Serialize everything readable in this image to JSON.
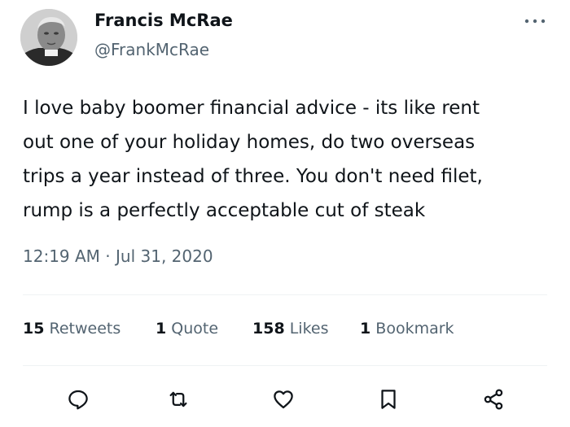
{
  "author": {
    "display_name": "Francis McRae",
    "handle": "@FrankMcRae",
    "avatar_icon": "profile-photo"
  },
  "more_icon": "more-horizontal-icon",
  "tweet": {
    "text_lines": [
      "I love baby boomer financial advice - its like rent",
      "out one of your holiday homes, do two overseas",
      "trips a year instead of three. You don't need filet,",
      "rump is a perfectly acceptable cut of steak"
    ],
    "timestamp": "12:19 AM · Jul 31, 2020"
  },
  "stats": [
    {
      "count": "15",
      "label": "Retweets"
    },
    {
      "count": "1",
      "label": "Quote"
    },
    {
      "count": "158",
      "label": "Likes"
    },
    {
      "count": "1",
      "label": "Bookmark"
    }
  ],
  "actions": [
    {
      "name": "reply",
      "icon": "reply-icon"
    },
    {
      "name": "retweet",
      "icon": "retweet-icon"
    },
    {
      "name": "like",
      "icon": "heart-icon"
    },
    {
      "name": "bookmark",
      "icon": "bookmark-icon"
    },
    {
      "name": "share",
      "icon": "share-icon"
    }
  ],
  "colors": {
    "text_primary": "#0f1419",
    "text_secondary": "#536471",
    "divider": "#eff3f4"
  }
}
